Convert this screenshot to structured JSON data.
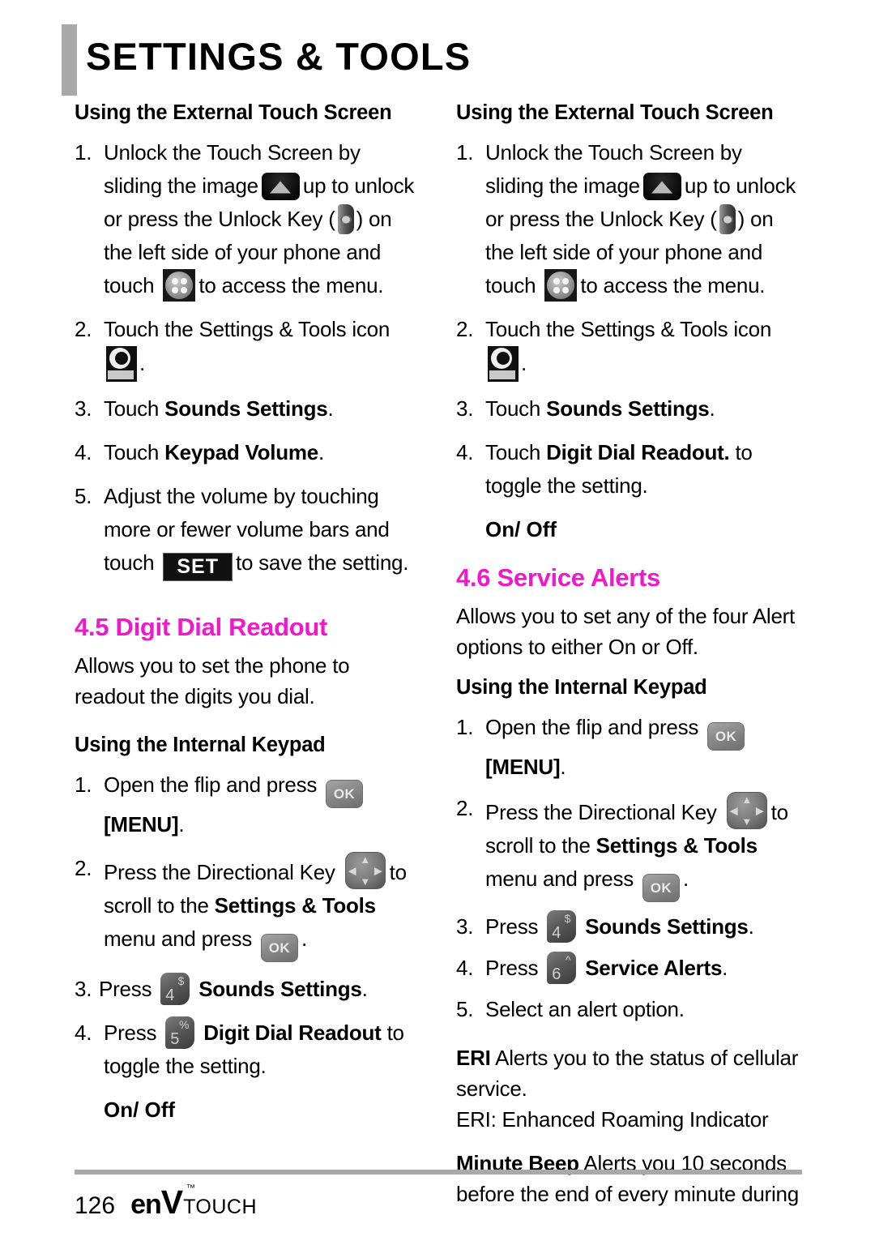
{
  "header": {
    "title": "SETTINGS & TOOLS"
  },
  "colors": {
    "accent_magenta": "#ef19c9",
    "rule_gray": "#a9a9a9",
    "text_black": "#000000"
  },
  "icons": {
    "unlock_image": "unlock-slide-image-icon",
    "unlock_key": "unlock-hardware-key-icon",
    "menu_dots": "menu-four-dots-icon",
    "settings_tools": "settings-and-tools-app-icon",
    "set_button": "SET",
    "ok_key": "OK",
    "directional_key": "directional-key-icon",
    "key4_digit": "4",
    "key4_sup": "$",
    "key5_digit": "5",
    "key5_sup": "%",
    "key6_digit": "6",
    "key6_sup": "^",
    "dir_up": "▲",
    "dir_down": "▼",
    "dir_left": "◀",
    "dir_right": "▶"
  },
  "left_column": {
    "heading_external": "Using the External Touch Screen",
    "step1": {
      "num": "1.",
      "t1": "Unlock the Touch Screen by sliding the image",
      "t2": "up to unlock or press the Unlock Key (",
      "t3": ") on the left side of your phone and touch",
      "t4": "to access the menu."
    },
    "step2": {
      "num": "2.",
      "t1": "Touch the Settings & Tools icon",
      "t2": "."
    },
    "step3": {
      "num": "3.",
      "t1": "Touch ",
      "b1": "Sounds Settings",
      "t2": "."
    },
    "step4": {
      "num": "4.",
      "t1": "Touch ",
      "b1": "Keypad Volume",
      "t2": "."
    },
    "step5": {
      "num": "5.",
      "t1": "Adjust the volume by touching more or fewer volume bars and touch",
      "t2": "to save the setting."
    },
    "section_heading": "4.5 Digit Dial Readout",
    "intro": "Allows you to set the phone to readout the digits you dial.",
    "heading_internal": "Using the Internal Keypad",
    "k1": {
      "num": "1.",
      "t1": "Open the flip and press",
      "b1": "[MENU]",
      "t2": "."
    },
    "k2": {
      "num": "2.",
      "t1": "Press the Directional Key",
      "t2": "to scroll to the ",
      "b1": "Settings & Tools",
      "t3": " menu and press",
      "t4": "."
    },
    "k3": {
      "num": "3.",
      "t1": "Press",
      "b1": "Sounds Settings",
      "t2": "."
    },
    "k4": {
      "num": "4.",
      "t1": "Press",
      "b1": "Digit Dial Readout",
      "t2": " to toggle the setting."
    },
    "on_off": "On/ Off"
  },
  "right_column": {
    "heading_external": "Using the External Touch Screen",
    "step1": {
      "num": "1.",
      "t1": "Unlock the Touch Screen by sliding the image",
      "t2": "up to unlock or press the Unlock Key (",
      "t3": ") on the left side of your phone and touch",
      "t4": "to access the menu."
    },
    "step2": {
      "num": "2.",
      "t1": "Touch the Settings & Tools icon",
      "t2": "."
    },
    "step3": {
      "num": "3.",
      "t1": "Touch ",
      "b1": "Sounds Settings",
      "t2": "."
    },
    "step4": {
      "num": "4.",
      "t1": "Touch ",
      "b1": "Digit Dial Readout.",
      "t2": " to toggle the setting."
    },
    "on_off": "On/ Off",
    "section_heading": "4.6 Service Alerts",
    "intro": "Allows you to set any of the four Alert options to either On or Off.",
    "heading_internal": "Using the Internal Keypad",
    "k1": {
      "num": "1.",
      "t1": "Open the flip and press",
      "b1": "[MENU]",
      "t2": "."
    },
    "k2": {
      "num": "2.",
      "t1": "Press the Directional Key",
      "t2": "to scroll to the ",
      "b1": "Settings & Tools",
      "t3": " menu and press",
      "t4": "."
    },
    "k3": {
      "num": "3.",
      "t1": "Press",
      "b1": "Sounds Settings",
      "t2": "."
    },
    "k4": {
      "num": "4.",
      "t1": "Press",
      "b1": "Service Alerts",
      "t2": "."
    },
    "k5": {
      "num": "5.",
      "t1": "Select an alert option."
    },
    "eri": {
      "term": "ERI",
      "desc": "  Alerts you to the status of cellular service.",
      "expansion": "ERI: Enhanced Roaming Indicator"
    },
    "minute_beep": {
      "term": "Minute Beep",
      "desc": "  Alerts you 10 seconds before the end of every minute during"
    }
  },
  "footer": {
    "page_number": "126",
    "brand_en": "en",
    "brand_v": "V",
    "brand_touch": "TOUCH",
    "brand_tm": "™"
  }
}
